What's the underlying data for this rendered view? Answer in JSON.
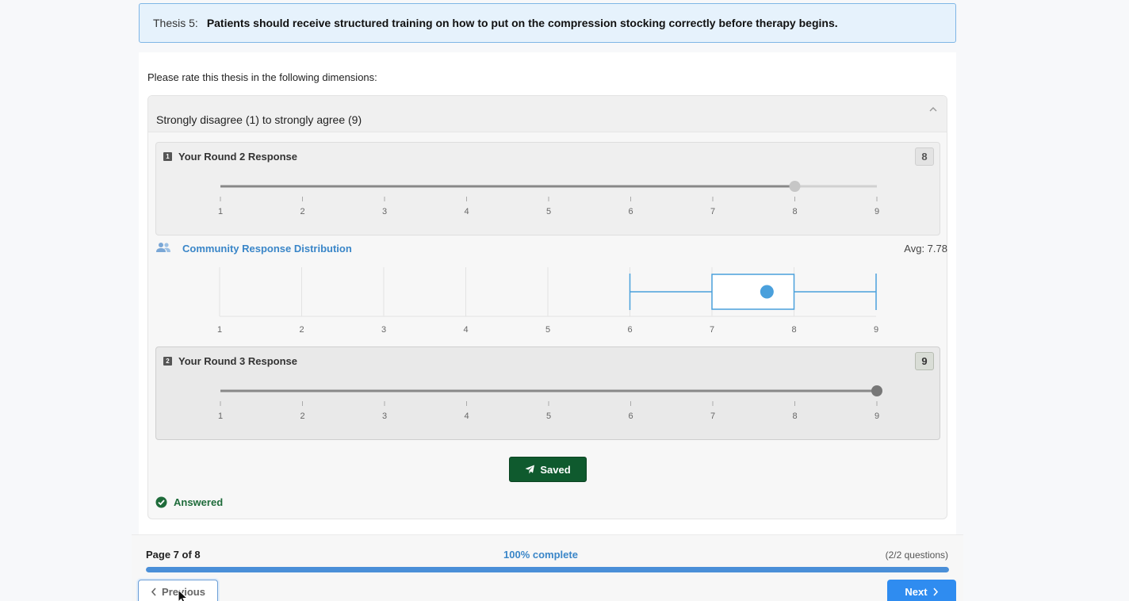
{
  "thesis": {
    "number_label": "Thesis 5:",
    "text": "Patients should receive structured training on how to put on the compression stocking correctly before therapy begins."
  },
  "prompt": "Please rate this thesis in the following dimensions:",
  "dimension": {
    "title": "Strongly disagree (1) to strongly agree (9)",
    "collapse_icon": "chevron-up-icon"
  },
  "scale": {
    "ticks": [
      "1",
      "2",
      "3",
      "4",
      "5",
      "6",
      "7",
      "8",
      "9"
    ]
  },
  "round2": {
    "badge": "1",
    "title": "Your Round 2 Response",
    "value": "8",
    "slider_value": 8
  },
  "community": {
    "icon": "users-icon",
    "title": "Community Response Distribution",
    "avg_label": "Avg: 7.78",
    "boxplot": {
      "min": 6,
      "q1": 7,
      "median": 7.67,
      "q3": 8,
      "max": 9
    }
  },
  "round3": {
    "badge": "2",
    "title": "Your Round 3 Response",
    "value": "9",
    "slider_value": 9
  },
  "saved_button": {
    "label": "Saved",
    "icon": "send-icon"
  },
  "answered": {
    "label": "Answered",
    "icon": "check-circle-icon"
  },
  "footer": {
    "page_label": "Page 7 of 8",
    "percent_label": "100% complete",
    "questions_label": "(2/2 questions)",
    "progress": 1.0,
    "previous_label": "Previous",
    "next_label": "Next"
  },
  "colors": {
    "accent": "#3a86c8",
    "saved_green": "#0f5a2e",
    "next_blue": "#2f8cf0",
    "boxplot_blue": "#4aa0dc"
  }
}
